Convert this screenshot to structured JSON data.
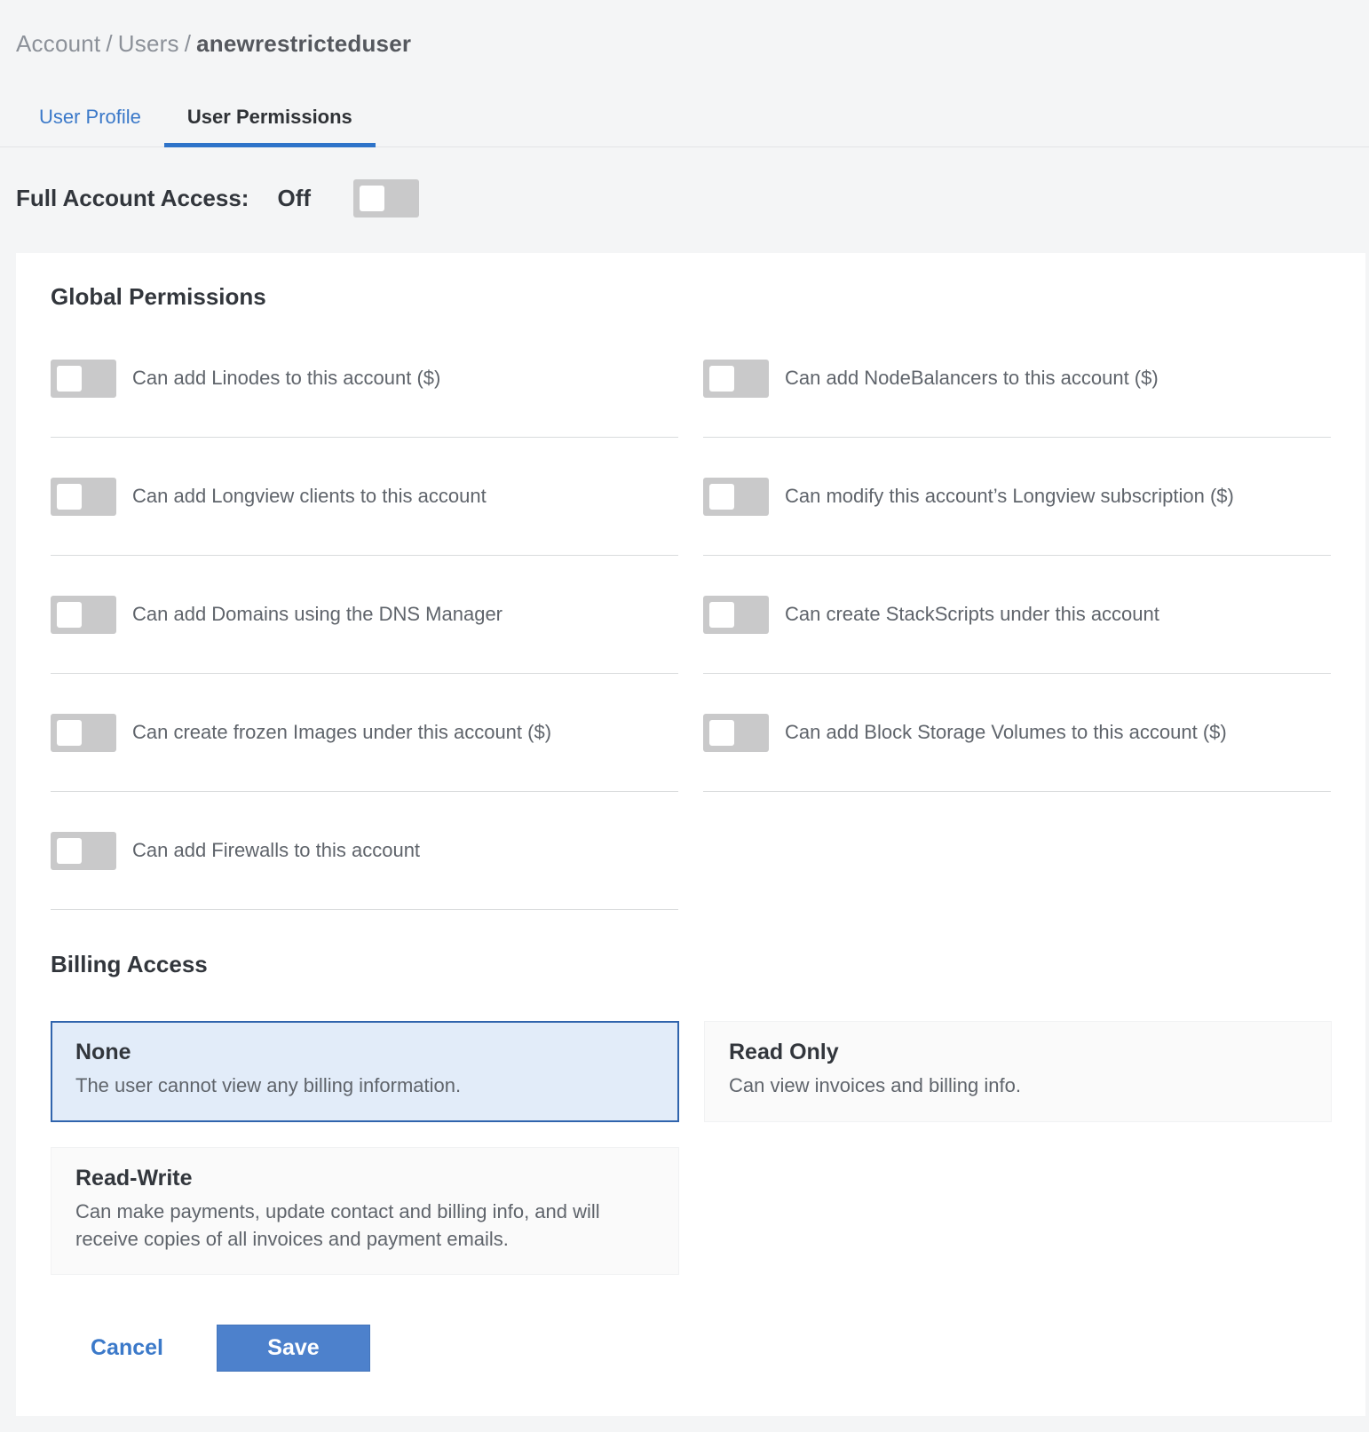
{
  "breadcrumb": {
    "segments": [
      "Account",
      "Users"
    ],
    "separator": "/",
    "current": "anewrestricteduser"
  },
  "tabs": [
    {
      "label": "User Profile",
      "active": false
    },
    {
      "label": "User Permissions",
      "active": true
    }
  ],
  "full_account_access": {
    "label": "Full Account Access:",
    "state": "Off",
    "toggle_on": false
  },
  "global_permissions": {
    "title": "Global Permissions",
    "left": [
      {
        "label": "Can add Linodes to this account ($)",
        "enabled": false
      },
      {
        "label": "Can add Longview clients to this account",
        "enabled": false
      },
      {
        "label": "Can add Domains using the DNS Manager",
        "enabled": false
      },
      {
        "label": "Can create frozen Images under this account ($)",
        "enabled": false
      },
      {
        "label": "Can add Firewalls to this account",
        "enabled": false
      }
    ],
    "right": [
      {
        "label": "Can add NodeBalancers to this account ($)",
        "enabled": false
      },
      {
        "label": "Can modify this account’s Longview subscription ($)",
        "enabled": false
      },
      {
        "label": "Can create StackScripts under this account",
        "enabled": false
      },
      {
        "label": "Can add Block Storage Volumes to this account ($)",
        "enabled": false
      }
    ]
  },
  "billing": {
    "title": "Billing Access",
    "options": [
      {
        "name": "None",
        "description": "The user cannot view any billing information.",
        "selected": true
      },
      {
        "name": "Read Only",
        "description": "Can view invoices and billing info.",
        "selected": false
      },
      {
        "name": "Read-Write",
        "description": "Can make payments, update contact and billing info, and will receive copies of all invoices and payment emails.",
        "selected": false
      }
    ]
  },
  "actions": {
    "cancel_label": "Cancel",
    "save_label": "Save"
  },
  "colors": {
    "page_background": "#f4f5f6",
    "card_background": "#ffffff",
    "accent_blue": "#2e73c9",
    "link_blue": "#3b79c9",
    "save_button": "#4d81cc",
    "toggle_track": "#c9c9ca",
    "selected_card_background": "#e2ecf9",
    "selected_card_border": "#3064ad",
    "text_dark": "#32363c",
    "text_gray": "#5f646b",
    "divider": "#d9dbdd"
  }
}
